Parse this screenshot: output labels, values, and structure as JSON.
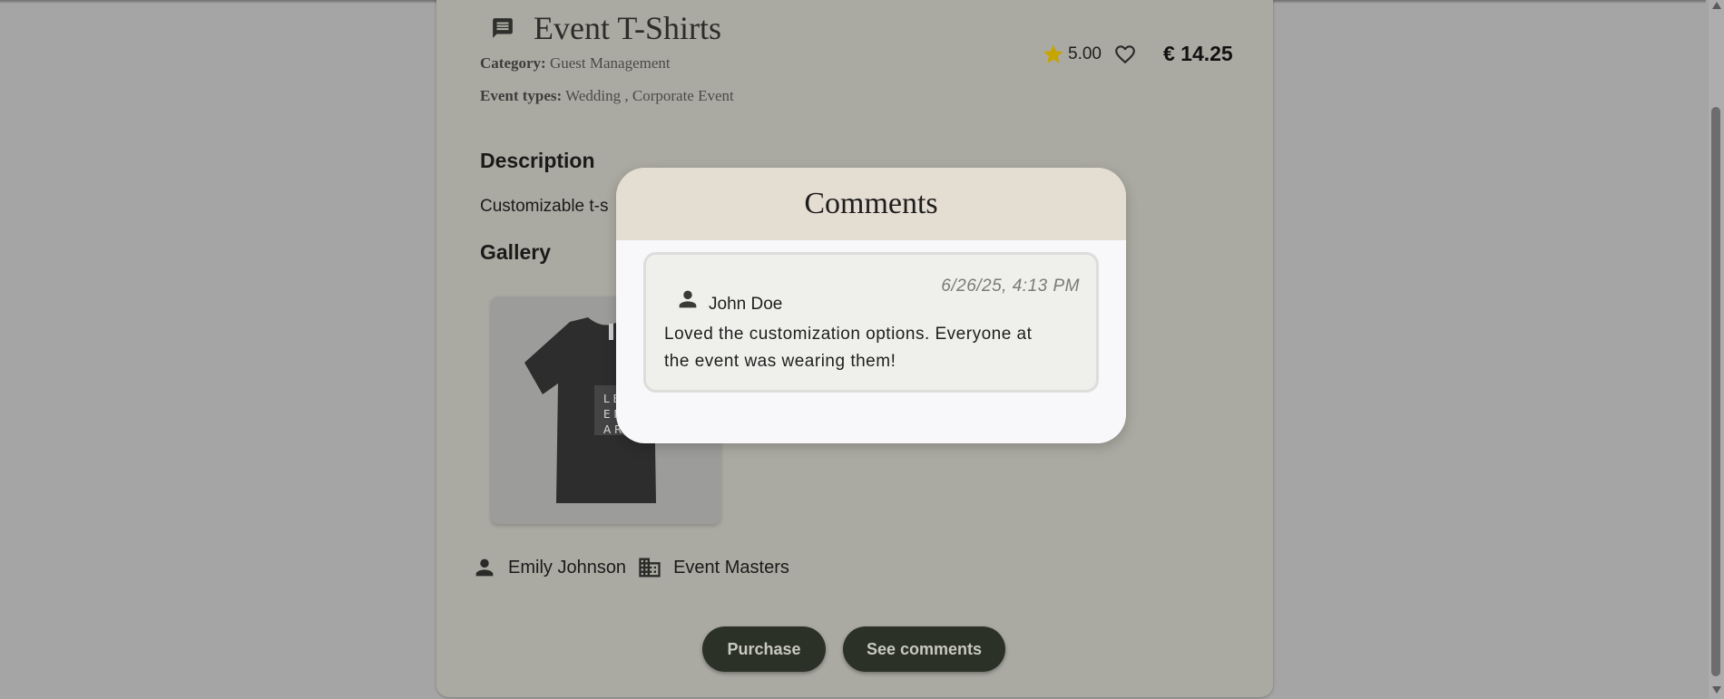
{
  "product": {
    "title": "Event T-Shirts",
    "category_label": "Category:",
    "category_value": "Guest Management",
    "event_types_label": "Event types:",
    "event_types_value": "Wedding , Corporate Event",
    "rating": "5.00",
    "price": "€ 14.25",
    "description_heading": "Description",
    "description_text": "Customizable t-s",
    "gallery_heading": "Gallery",
    "gallery_shirt_text": "L E E N A R",
    "owner_name": "Emily Johnson",
    "company_name": "Event Masters"
  },
  "buttons": {
    "purchase": "Purchase",
    "see_comments": "See comments"
  },
  "modal": {
    "title": "Comments",
    "comments": [
      {
        "author": "John Doe",
        "timestamp": "6/26/25, 4:13 PM",
        "text": "Loved the customization options. Everyone at the event was wearing them!"
      }
    ]
  },
  "colors": {
    "overlay": "#a5a5a5",
    "card": "#abaaa2",
    "button_bg": "#2b3126",
    "star": "#c7a500",
    "modal_header": "#e4ddd1"
  },
  "icons": {
    "title": "comment-icon",
    "rating": "star-icon",
    "favorite": "heart-outline-icon",
    "owner": "person-icon",
    "company": "building-icon",
    "comment_author": "person-icon"
  }
}
